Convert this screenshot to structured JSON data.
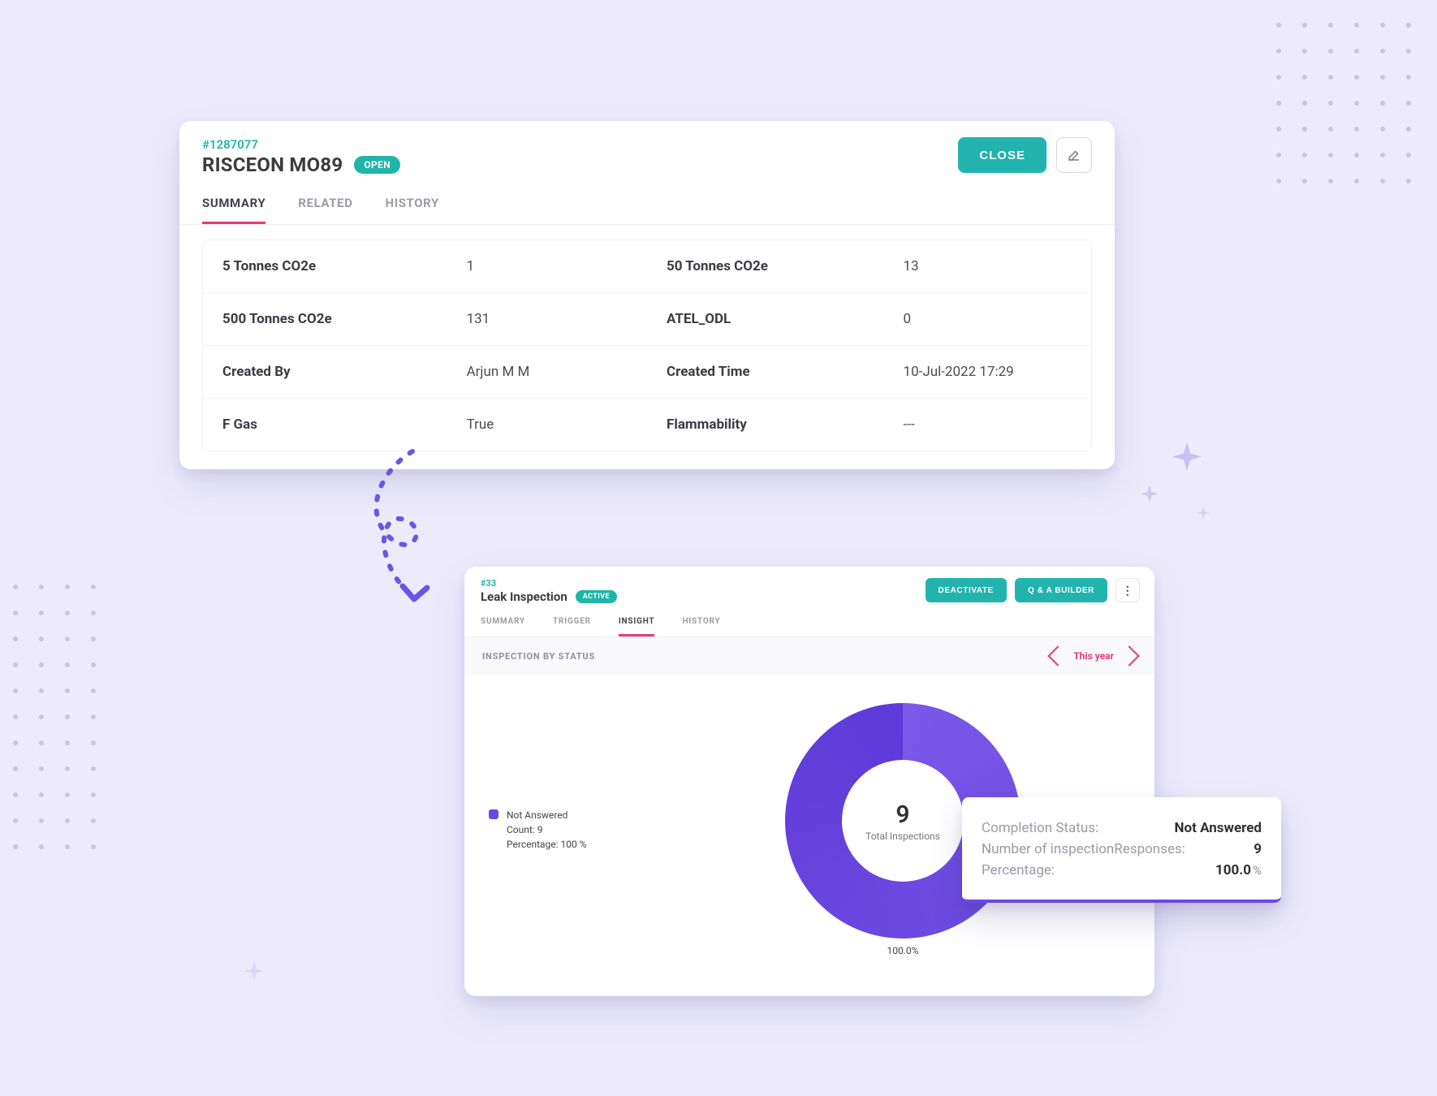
{
  "cardA": {
    "record_id": "#1287077",
    "title": "RISCEON MO89",
    "status_badge": "OPEN",
    "close_button": "CLOSE",
    "tabs": {
      "summary": "SUMMARY",
      "related": "RELATED",
      "history": "HISTORY"
    },
    "rows": [
      {
        "l1": "5 Tonnes CO2e",
        "v1": "1",
        "l2": "50 Tonnes CO2e",
        "v2": "13"
      },
      {
        "l1": "500 Tonnes CO2e",
        "v1": "131",
        "l2": "ATEL_ODL",
        "v2": "0"
      },
      {
        "l1": "Created By",
        "v1": "Arjun M M",
        "l2": "Created Time",
        "v2": "10-Jul-2022 17:29"
      },
      {
        "l1": "F Gas",
        "v1": "True",
        "l2": "Flammability",
        "v2": "---"
      }
    ]
  },
  "cardB": {
    "record_id": "#33",
    "title": "Leak Inspection",
    "status_badge": "ACTIVE",
    "deactivate_button": "DEACTIVATE",
    "qabuilder_button": "Q & A BUILDER",
    "tabs": {
      "summary": "SUMMARY",
      "trigger": "TRIGGER",
      "insight": "INSIGHT",
      "history": "HISTORY"
    },
    "section_title": "INSPECTION BY STATUS",
    "range_label": "This year",
    "legend": {
      "name": "Not Answered",
      "count_line": "Count: 9",
      "pct_line": "Percentage: 100 %"
    },
    "center_total": "9",
    "center_label": "Total Inspections",
    "slice_pct": "100.0%"
  },
  "tooltip": {
    "k1": "Completion Status:",
    "v1": "Not Answered",
    "k2": "Number of inspectionResponses:",
    "v2": "9",
    "k3": "Percentage:",
    "v3": "100.0",
    "v3_unit": "%"
  },
  "chart_data": {
    "type": "pie",
    "title": "Inspection by Status",
    "series": [
      {
        "name": "Not Answered",
        "value": 9,
        "percentage": 100.0,
        "color": "#6C48E3"
      }
    ],
    "total": 9,
    "total_label": "Total Inspections",
    "range": "This year"
  }
}
